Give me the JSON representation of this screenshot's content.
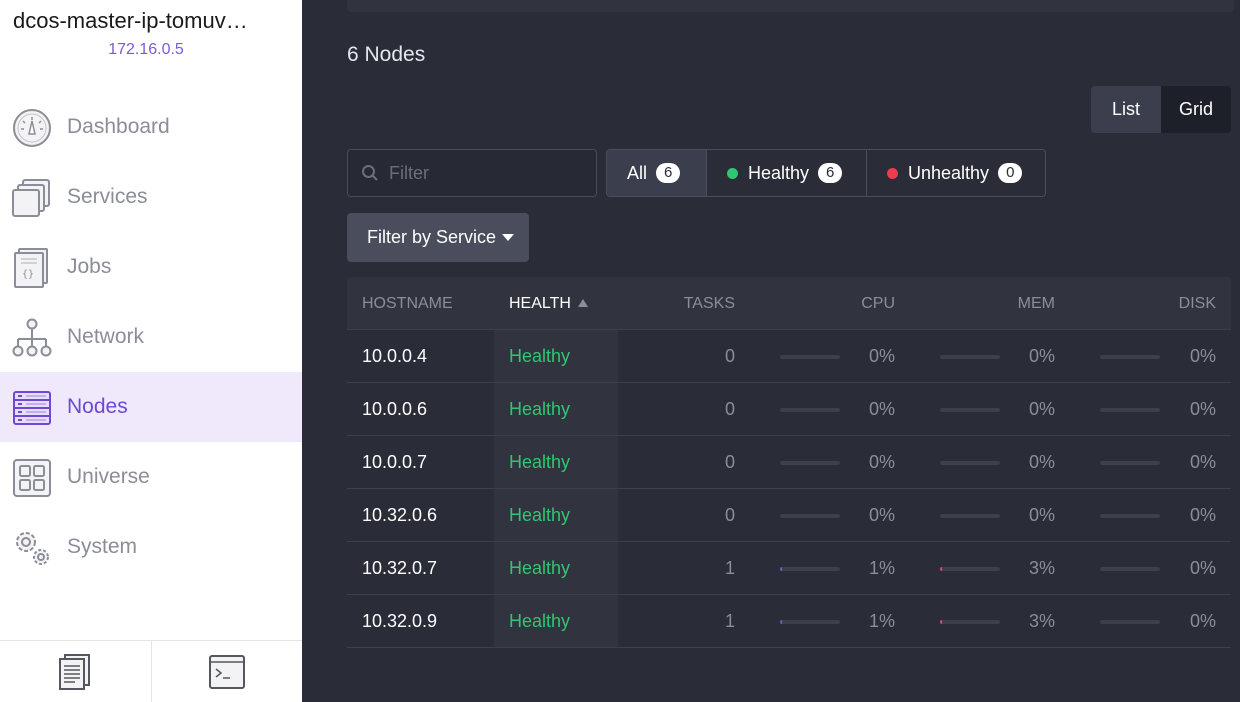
{
  "sidebar": {
    "cluster_name": "dcos-master-ip-tomuv…",
    "cluster_ip": "172.16.0.5",
    "nav": [
      {
        "label": "Dashboard",
        "icon": "dashboard-icon"
      },
      {
        "label": "Services",
        "icon": "services-icon"
      },
      {
        "label": "Jobs",
        "icon": "jobs-icon"
      },
      {
        "label": "Network",
        "icon": "network-icon"
      },
      {
        "label": "Nodes",
        "icon": "nodes-icon",
        "active": true
      },
      {
        "label": "Universe",
        "icon": "universe-icon"
      },
      {
        "label": "System",
        "icon": "system-icon"
      }
    ],
    "footer": [
      {
        "icon": "docs-icon"
      },
      {
        "icon": "cli-icon"
      }
    ]
  },
  "main": {
    "title": "6 Nodes",
    "view_toggle": {
      "list": "List",
      "grid": "Grid",
      "active": "List"
    },
    "filter": {
      "placeholder": "Filter"
    },
    "health_filter": {
      "all": {
        "label": "All",
        "count": "6"
      },
      "healthy": {
        "label": "Healthy",
        "count": "6"
      },
      "unhealthy": {
        "label": "Unhealthy",
        "count": "0"
      }
    },
    "service_filter": {
      "label": "Filter by Service"
    },
    "table": {
      "columns": {
        "hostname": "HOSTNAME",
        "health": "HEALTH",
        "tasks": "TASKS",
        "cpu": "CPU",
        "mem": "MEM",
        "disk": "DISK"
      },
      "rows": [
        {
          "hostname": "10.0.0.4",
          "health": "Healthy",
          "tasks": "0",
          "cpu": "0%",
          "cpu_frac": 0,
          "mem": "0%",
          "mem_frac": 0,
          "disk": "0%",
          "disk_frac": 0
        },
        {
          "hostname": "10.0.0.6",
          "health": "Healthy",
          "tasks": "0",
          "cpu": "0%",
          "cpu_frac": 0,
          "mem": "0%",
          "mem_frac": 0,
          "disk": "0%",
          "disk_frac": 0
        },
        {
          "hostname": "10.0.0.7",
          "health": "Healthy",
          "tasks": "0",
          "cpu": "0%",
          "cpu_frac": 0,
          "mem": "0%",
          "mem_frac": 0,
          "disk": "0%",
          "disk_frac": 0
        },
        {
          "hostname": "10.32.0.6",
          "health": "Healthy",
          "tasks": "0",
          "cpu": "0%",
          "cpu_frac": 0,
          "mem": "0%",
          "mem_frac": 0,
          "disk": "0%",
          "disk_frac": 0
        },
        {
          "hostname": "10.32.0.7",
          "health": "Healthy",
          "tasks": "1",
          "cpu": "1%",
          "cpu_frac": 0.01,
          "mem": "3%",
          "mem_frac": 0.03,
          "disk": "0%",
          "disk_frac": 0
        },
        {
          "hostname": "10.32.0.9",
          "health": "Healthy",
          "tasks": "1",
          "cpu": "1%",
          "cpu_frac": 0.01,
          "mem": "3%",
          "mem_frac": 0.03,
          "disk": "0%",
          "disk_frac": 0
        }
      ]
    }
  },
  "colors": {
    "accent": "#6f47d3",
    "healthy": "#2ec772",
    "unhealthy": "#ef3b4e",
    "cpu_bar": "#5b5fd6",
    "mem_bar": "#e0407f"
  }
}
